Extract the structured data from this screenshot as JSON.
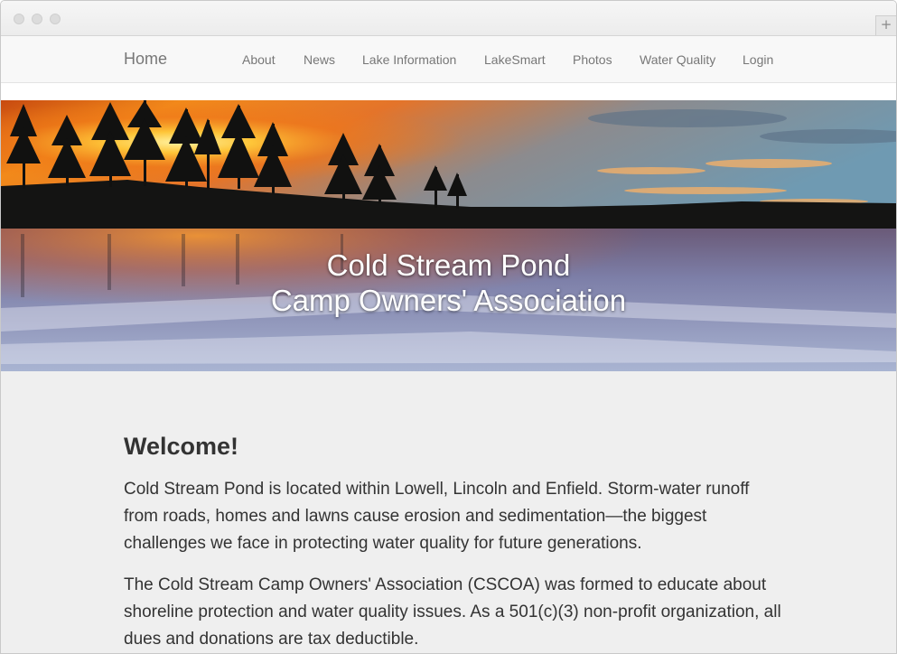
{
  "nav": {
    "brand": "Home",
    "items": [
      {
        "label": "About"
      },
      {
        "label": "News"
      },
      {
        "label": "Lake Information"
      },
      {
        "label": "LakeSmart"
      },
      {
        "label": "Photos"
      },
      {
        "label": "Water Quality"
      },
      {
        "label": "Login"
      }
    ]
  },
  "hero": {
    "title_line1": "Cold Stream Pond",
    "title_line2": "Camp Owners' Association"
  },
  "main": {
    "heading": "Welcome!",
    "paragraphs": [
      "Cold Stream Pond is located within Lowell, Lincoln and Enfield. Storm-water runoff from roads, homes and lawns cause erosion and sedimentation—the biggest challenges we face in protecting water quality for future generations.",
      "The Cold Stream Camp Owners' Association (CSCOA) was formed to educate about shoreline protection and water quality issues. As a 501(c)(3) non-profit organization, all dues and donations are tax deductible."
    ]
  },
  "browser": {
    "new_tab_icon": "+"
  },
  "colors": {
    "nav_text": "#777777",
    "body_text": "#333333",
    "page_bg": "#efefef"
  }
}
